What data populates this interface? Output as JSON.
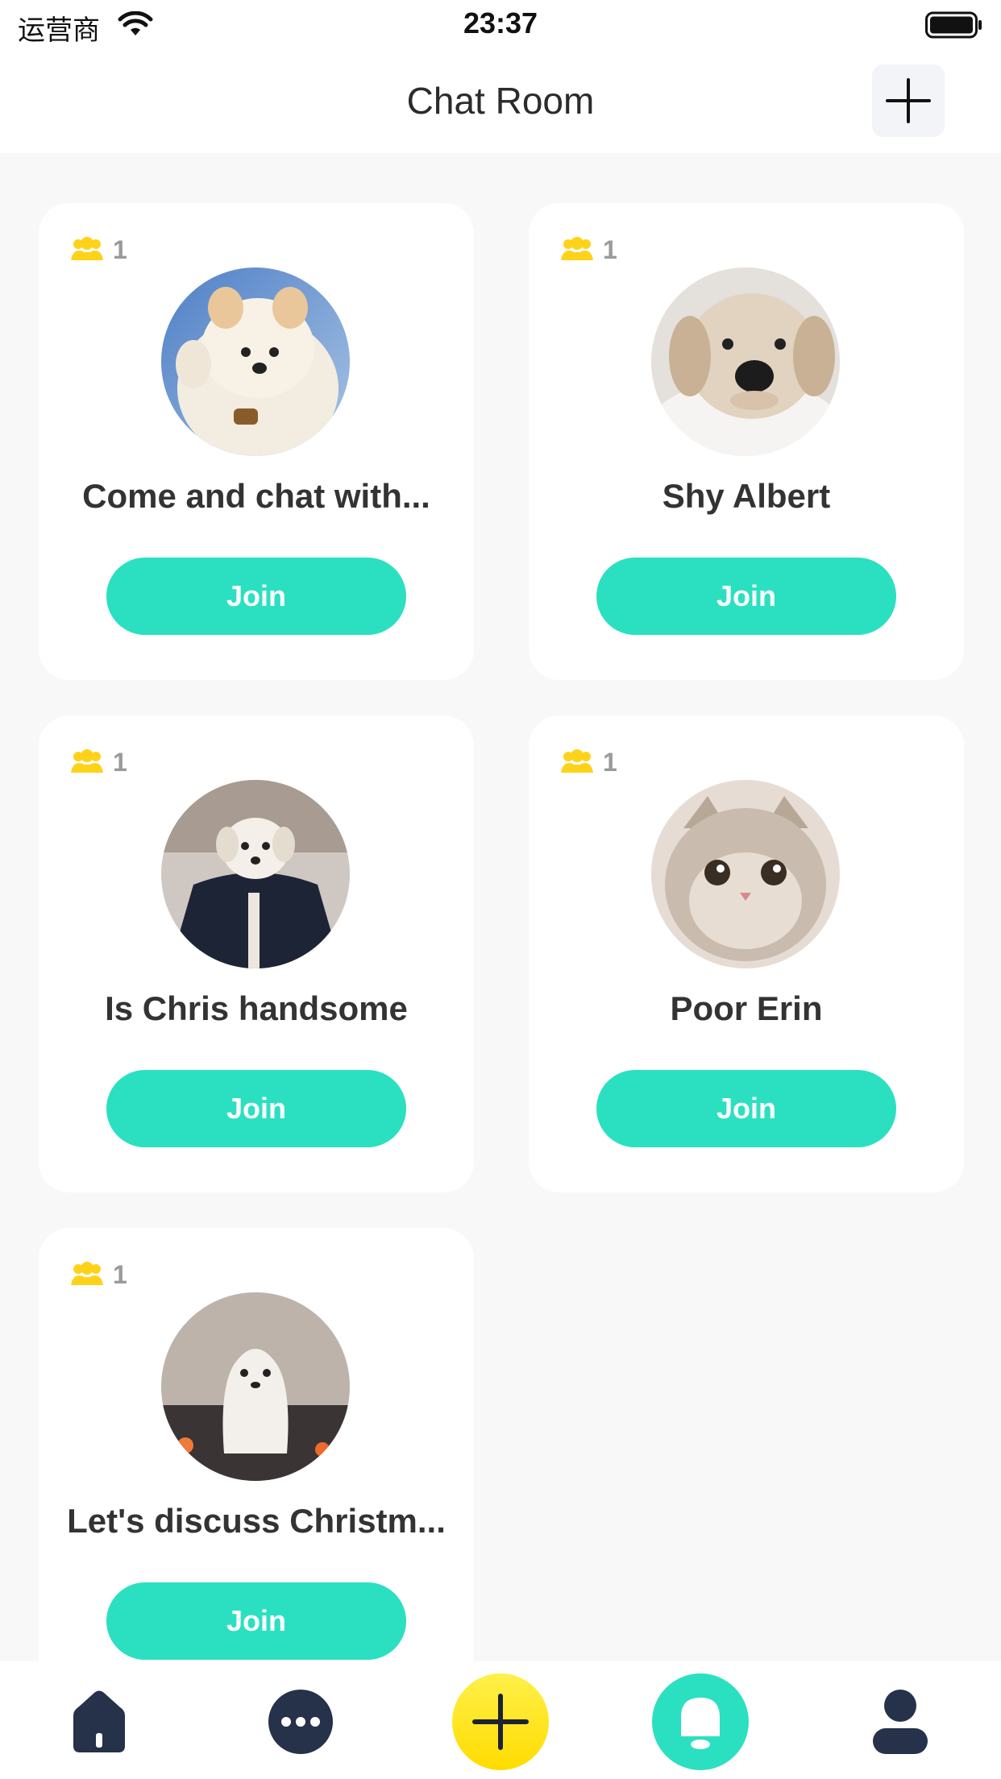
{
  "status_bar": {
    "carrier": "运营商",
    "time": "23:37"
  },
  "header": {
    "title": "Chat Room"
  },
  "rooms": [
    {
      "name": "Come and chat with...",
      "members": "1",
      "join_label": "Join"
    },
    {
      "name": "Shy Albert",
      "members": "1",
      "join_label": "Join"
    },
    {
      "name": "Is Chris handsome",
      "members": "1",
      "join_label": "Join"
    },
    {
      "name": "Poor Erin",
      "members": "1",
      "join_label": "Join"
    },
    {
      "name": "Let's discuss Christm...",
      "members": "1",
      "join_label": "Join"
    }
  ],
  "tab_bar": {
    "items": [
      "home-icon",
      "chat-bubble-icon",
      "plus-icon",
      "notification-bell-icon",
      "profile-icon"
    ]
  },
  "colors": {
    "accent_teal": "#2be0c0",
    "accent_yellow": "#ffe600",
    "member_icon": "#ffd21a",
    "dark_icon": "#26314a"
  }
}
